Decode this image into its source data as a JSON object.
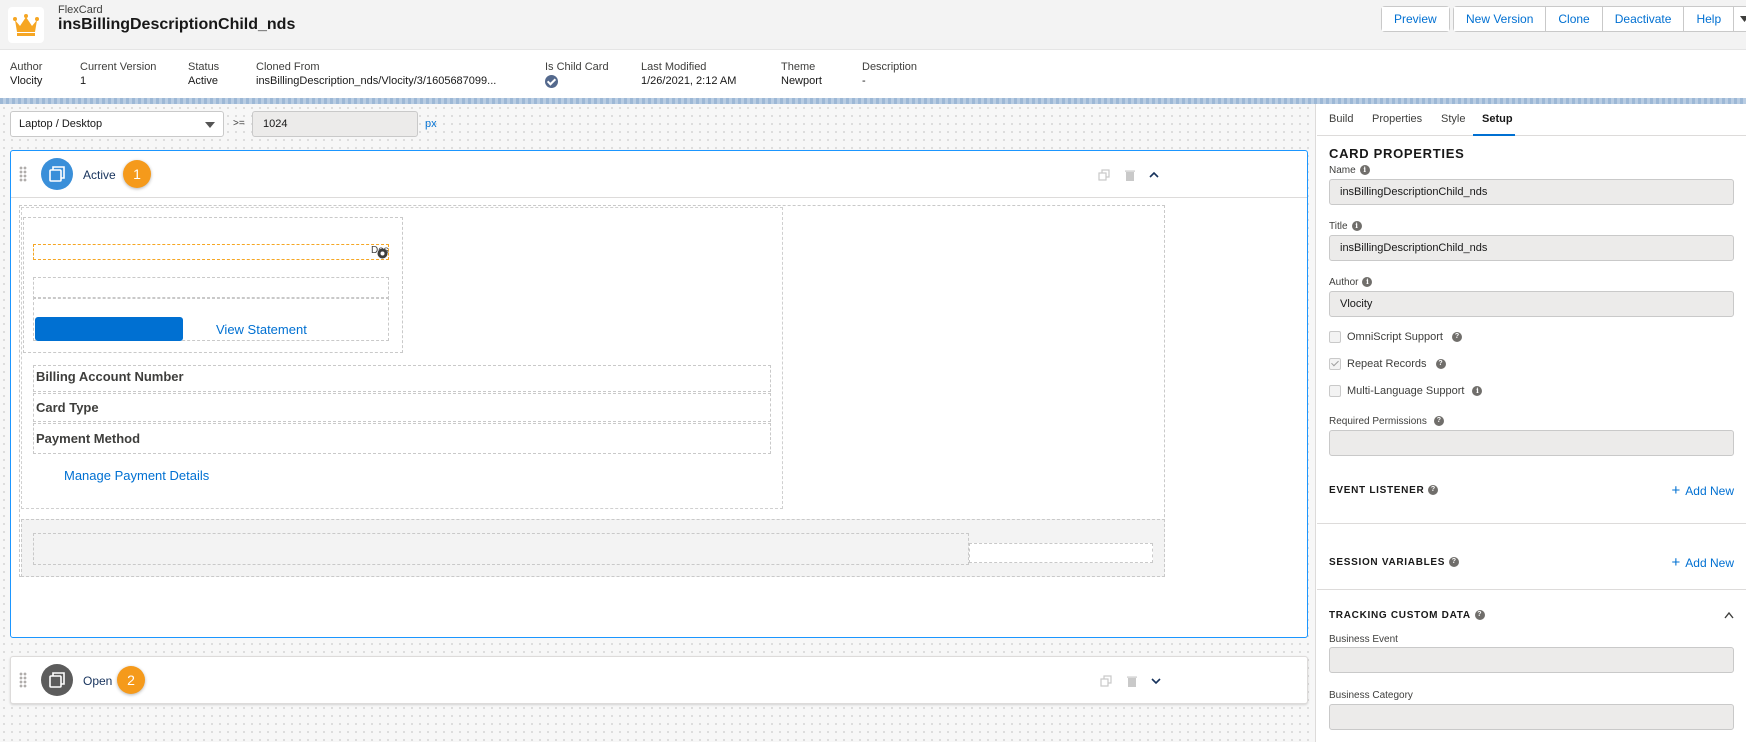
{
  "header": {
    "app_type": "FlexCard",
    "card_name": "insBillingDescriptionChild_nds",
    "buttons": [
      "Preview",
      "New Version",
      "Clone",
      "Deactivate",
      "Help"
    ]
  },
  "meta": [
    {
      "label": "Author",
      "value": "Vlocity"
    },
    {
      "label": "Current Version",
      "value": "1"
    },
    {
      "label": "Status",
      "value": "Active"
    },
    {
      "label": "Cloned From",
      "value": "insBillingDescription_nds/Vlocity/3/1605687099..."
    },
    {
      "label": "Is Child Card",
      "value": ""
    },
    {
      "label": "Last Modified",
      "value": "1/26/2021, 2:12 AM"
    },
    {
      "label": "Theme",
      "value": "Newport"
    },
    {
      "label": "Description",
      "value": "-"
    }
  ],
  "toolbar": {
    "device": "Laptop / Desktop",
    "ge": ">=",
    "width": "1024",
    "unit": "px"
  },
  "states": [
    {
      "name": "Active",
      "number": "1"
    },
    {
      "name": "Open",
      "number": "2"
    }
  ],
  "card_body": {
    "truncated_label": "Des",
    "view_statement": "View Statement",
    "fields": [
      "Billing Account Number",
      "Card Type",
      "Payment Method"
    ],
    "manage_link": "Manage Payment Details"
  },
  "panel": {
    "tabs": [
      "Build",
      "Properties",
      "Style",
      "Setup"
    ],
    "active_tab": "Setup",
    "section_title": "CARD PROPERTIES",
    "name_label": "Name",
    "name_value": "insBillingDescriptionChild_nds",
    "title_label": "Title",
    "title_value": "insBillingDescriptionChild_nds",
    "author_label": "Author",
    "author_value": "Vlocity",
    "checkboxes": [
      {
        "label": "OmniScript Support",
        "checked": false
      },
      {
        "label": "Repeat Records",
        "checked": true
      },
      {
        "label": "Multi-Language Support",
        "checked": false
      }
    ],
    "required_permissions_label": "Required Permissions",
    "event_listener": "EVENT LISTENER",
    "session_variables": "SESSION VARIABLES",
    "add_new": "Add New",
    "tracking": "TRACKING CUSTOM DATA",
    "business_event": "Business Event",
    "business_category": "Business Category"
  },
  "colors": {
    "accent": "#0070d2",
    "badge": "#f59a1b",
    "active_border": "#1b96ff"
  }
}
